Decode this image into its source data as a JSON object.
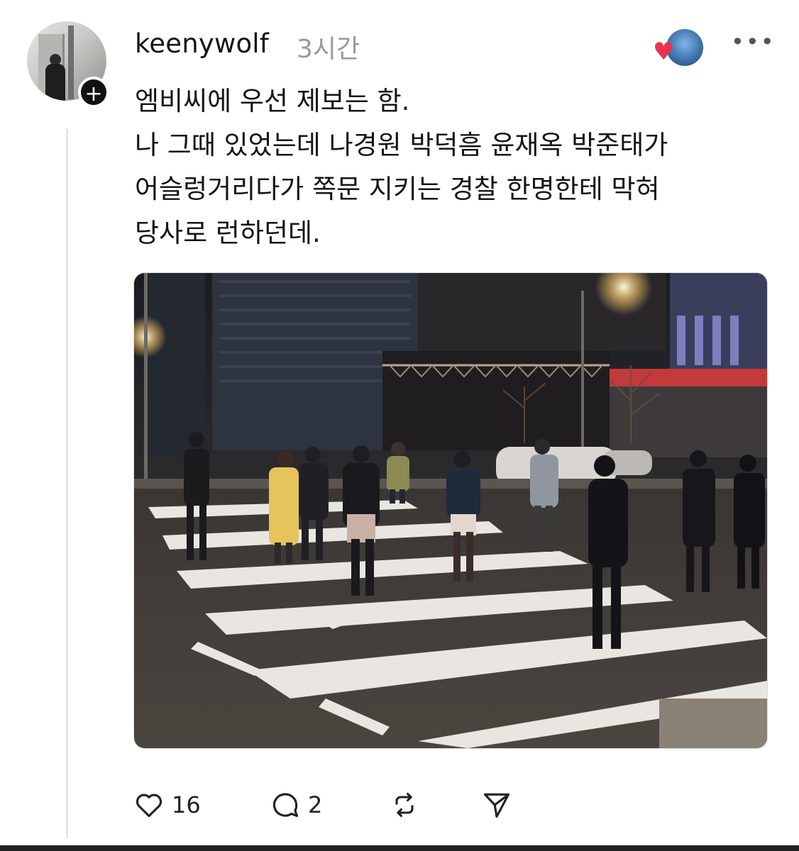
{
  "post": {
    "username": "keenywolf",
    "timestamp": "3시간",
    "follow_symbol": "+",
    "more_symbol": "•••",
    "reaction_heart": "♥",
    "body_lines": [
      "엠비씨에 우선 제보는 함.",
      "나 그때 있었는데 나경원 박덕흠 윤재옥 박준태가",
      "어슬렁거리다가 쪽문 지키는 경찰 한명한테 막혀",
      "당사로 런하던데."
    ]
  },
  "actions": {
    "like_count": "16",
    "reply_count": "2",
    "icons": [
      "heart-icon",
      "comment-icon",
      "repost-icon",
      "share-icon"
    ]
  },
  "colors": {
    "text": "#141414",
    "muted": "#9a9a9a",
    "heart": "#e8344e"
  }
}
